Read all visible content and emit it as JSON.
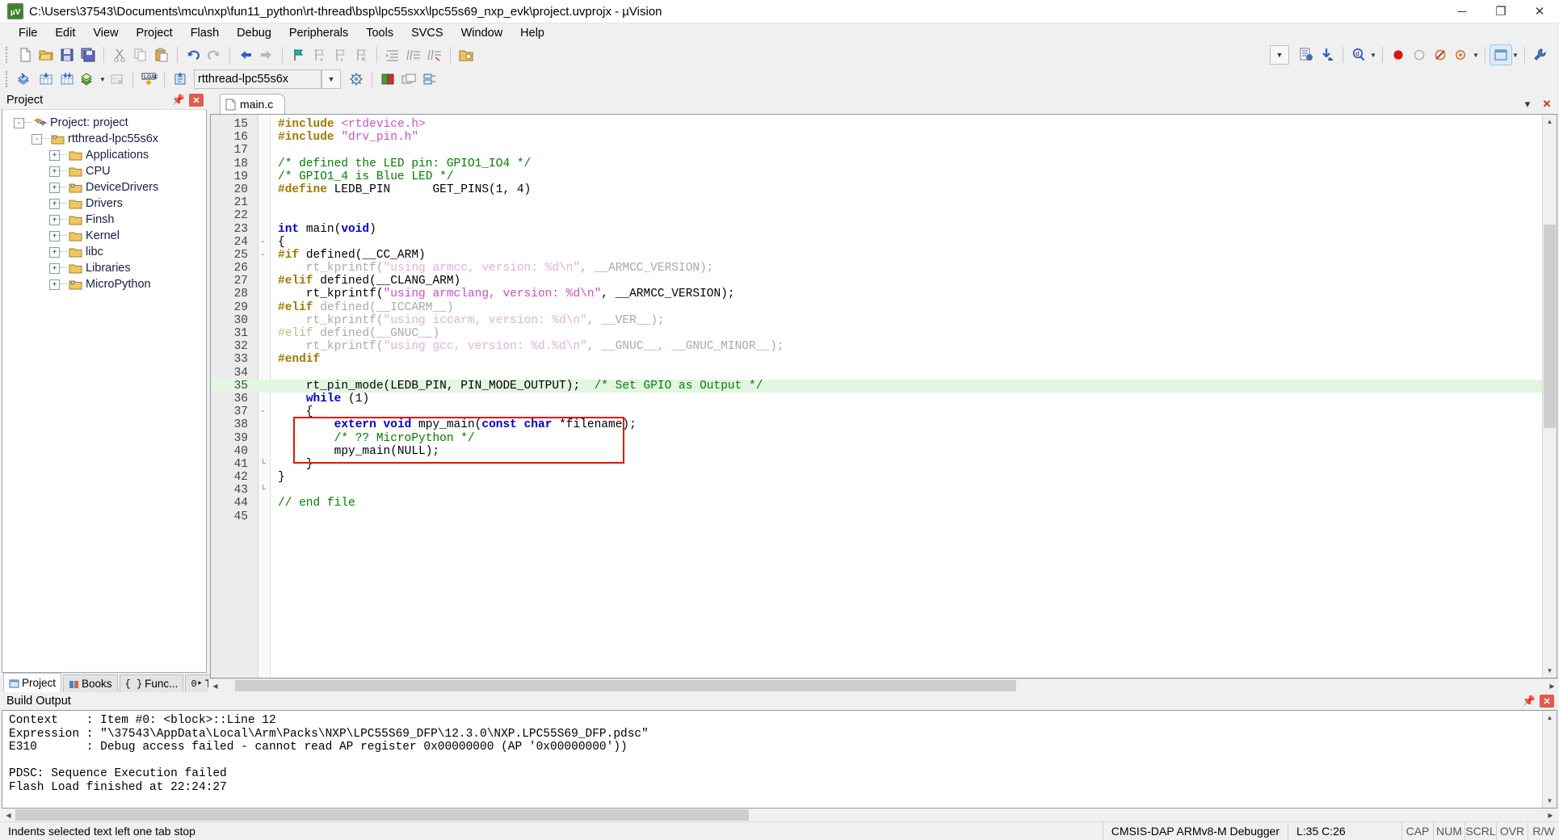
{
  "window": {
    "title": "C:\\Users\\37543\\Documents\\mcu\\nxp\\fun11_python\\rt-thread\\bsp\\lpc55sxx\\lpc55s69_nxp_evk\\project.uvprojx - µVision",
    "app_icon": "uvision-icon",
    "minimize": "─",
    "maximize": "❐",
    "close": "✕"
  },
  "menu": [
    {
      "label": "File"
    },
    {
      "label": "Edit"
    },
    {
      "label": "View"
    },
    {
      "label": "Project"
    },
    {
      "label": "Flash"
    },
    {
      "label": "Debug"
    },
    {
      "label": "Peripherals"
    },
    {
      "label": "Tools"
    },
    {
      "label": "SVCS"
    },
    {
      "label": "Window"
    },
    {
      "label": "Help"
    }
  ],
  "toolbar_main": [
    {
      "name": "new-file-icon"
    },
    {
      "name": "open-file-icon"
    },
    {
      "name": "save-icon"
    },
    {
      "name": "save-all-icon"
    },
    {
      "name": "cut-icon"
    },
    {
      "name": "copy-icon"
    },
    {
      "name": "paste-icon"
    },
    {
      "name": "undo-icon"
    },
    {
      "name": "redo-icon"
    },
    {
      "name": "navigate-back-icon"
    },
    {
      "name": "navigate-forward-icon"
    },
    {
      "name": "bookmark-toggle-icon"
    },
    {
      "name": "bookmark-prev-icon"
    },
    {
      "name": "bookmark-next-icon"
    },
    {
      "name": "bookmark-clear-icon"
    },
    {
      "name": "indent-icon"
    },
    {
      "name": "comment-icon"
    },
    {
      "name": "uncomment-icon"
    },
    {
      "name": "open-folder-icon"
    }
  ],
  "toolbar_right": [
    {
      "name": "combo-dropdown-icon"
    },
    {
      "name": "insert-file-icon"
    },
    {
      "name": "download-icon"
    },
    {
      "name": "find-in-files-icon"
    },
    {
      "name": "find-dropdown-icon"
    },
    {
      "name": "breakpoint-icon"
    },
    {
      "name": "breakpoint-disabled-icon"
    },
    {
      "name": "kill-breakpoints-icon"
    },
    {
      "name": "bookmarks-icon"
    },
    {
      "name": "bookmarks-dropdown-icon"
    },
    {
      "name": "window-layout-icon"
    },
    {
      "name": "window-layout-dropdown-icon"
    },
    {
      "name": "configure-icon"
    }
  ],
  "toolbar_build": [
    {
      "name": "translate-icon"
    },
    {
      "name": "build-icon"
    },
    {
      "name": "rebuild-icon"
    },
    {
      "name": "batch-build-icon"
    },
    {
      "name": "batch-build-dropdown-icon"
    },
    {
      "name": "stop-build-icon"
    },
    {
      "name": "download-flash-icon"
    },
    {
      "name": "target-options-icon"
    },
    {
      "name": "manage-project-items-icon"
    },
    {
      "name": "manage-run-time-icon"
    },
    {
      "name": "pack-installer-icon"
    },
    {
      "name": "manage-multi-project-icon"
    }
  ],
  "target": {
    "name": "rtthread-lpc55s6x",
    "dropdown_icon": "chevron-down-icon"
  },
  "project_pane": {
    "title": "Project",
    "pin_icon": "pin-icon",
    "close_icon": "close-icon",
    "tree": [
      {
        "label": "Project: project",
        "depth": 0,
        "expander": "-",
        "icon": "project-icon"
      },
      {
        "label": "rtthread-lpc55s6x",
        "depth": 1,
        "expander": "-",
        "icon": "target-folder-icon"
      },
      {
        "label": "Applications",
        "depth": 2,
        "expander": "+",
        "icon": "folder-icon"
      },
      {
        "label": "CPU",
        "depth": 2,
        "expander": "+",
        "icon": "folder-icon"
      },
      {
        "label": "DeviceDrivers",
        "depth": 2,
        "expander": "+",
        "icon": "folder-gear-icon"
      },
      {
        "label": "Drivers",
        "depth": 2,
        "expander": "+",
        "icon": "folder-icon"
      },
      {
        "label": "Finsh",
        "depth": 2,
        "expander": "+",
        "icon": "folder-icon"
      },
      {
        "label": "Kernel",
        "depth": 2,
        "expander": "+",
        "icon": "folder-icon"
      },
      {
        "label": "libc",
        "depth": 2,
        "expander": "+",
        "icon": "folder-icon"
      },
      {
        "label": "Libraries",
        "depth": 2,
        "expander": "+",
        "icon": "folder-icon"
      },
      {
        "label": "MicroPython",
        "depth": 2,
        "expander": "+",
        "icon": "folder-gear-icon"
      }
    ],
    "tabs": [
      {
        "label": "Project",
        "icon": "project-tab-icon",
        "active": true
      },
      {
        "label": "Books",
        "icon": "books-tab-icon",
        "active": false
      },
      {
        "label": "Func...",
        "icon": "functions-tab-icon",
        "active": false
      },
      {
        "label": "Temp...",
        "icon": "templates-tab-icon",
        "active": false
      }
    ]
  },
  "editor": {
    "tabs": [
      {
        "label": "main.c",
        "icon": "c-file-icon",
        "active": true
      }
    ],
    "window_minimize_icon": "▾",
    "window_close_icon": "✕",
    "highlight_line": 35,
    "red_box_lines": [
      38,
      40
    ],
    "lines": [
      {
        "num": 15,
        "fold": "",
        "tokens": [
          {
            "t": "#include ",
            "c": "pp"
          },
          {
            "t": "<rtdevice.h>",
            "c": "str"
          }
        ]
      },
      {
        "num": 16,
        "fold": "",
        "tokens": [
          {
            "t": "#include ",
            "c": "pp"
          },
          {
            "t": "\"drv_pin.h\"",
            "c": "str"
          }
        ]
      },
      {
        "num": 17,
        "fold": "",
        "tokens": []
      },
      {
        "num": 18,
        "fold": "",
        "tokens": [
          {
            "t": "/* defined the LED pin: GPIO1_IO4 */",
            "c": "cm"
          }
        ]
      },
      {
        "num": 19,
        "fold": "",
        "tokens": [
          {
            "t": "/* GPIO1_4 is Blue LED */",
            "c": "cm"
          }
        ]
      },
      {
        "num": 20,
        "fold": "",
        "tokens": [
          {
            "t": "#define ",
            "c": "pp"
          },
          {
            "t": "LEDB_PIN      GET_PINS(",
            "c": "id"
          },
          {
            "t": "1",
            "c": "num-lit"
          },
          {
            "t": ", ",
            "c": "id"
          },
          {
            "t": "4",
            "c": "num-lit"
          },
          {
            "t": ")",
            "c": "id"
          }
        ]
      },
      {
        "num": 21,
        "fold": "",
        "tokens": []
      },
      {
        "num": 22,
        "fold": "",
        "tokens": []
      },
      {
        "num": 23,
        "fold": "",
        "tokens": [
          {
            "t": "int ",
            "c": "k"
          },
          {
            "t": "main(",
            "c": "id"
          },
          {
            "t": "void",
            "c": "k"
          },
          {
            "t": ")",
            "c": "id"
          }
        ]
      },
      {
        "num": 24,
        "fold": "-",
        "tokens": [
          {
            "t": "{",
            "c": "id"
          }
        ]
      },
      {
        "num": 25,
        "fold": "-",
        "tokens": [
          {
            "t": "#if ",
            "c": "pp"
          },
          {
            "t": "defined(__CC_ARM)",
            "c": "id"
          }
        ]
      },
      {
        "num": 26,
        "fold": "",
        "tokens": [
          {
            "t": "    rt_kprintf(",
            "c": "dim"
          },
          {
            "t": "\"using armcc, version: %d\\n\"",
            "c": "str-dim"
          },
          {
            "t": ", __ARMCC_VERSION);",
            "c": "dim"
          }
        ]
      },
      {
        "num": 27,
        "fold": "",
        "tokens": [
          {
            "t": "#elif ",
            "c": "pp"
          },
          {
            "t": "defined(__CLANG_ARM)",
            "c": "id"
          }
        ]
      },
      {
        "num": 28,
        "fold": "",
        "tokens": [
          {
            "t": "    rt_kprintf(",
            "c": "id"
          },
          {
            "t": "\"using armclang, version: %d\\n\"",
            "c": "str"
          },
          {
            "t": ", __ARMCC_VERSION);",
            "c": "id"
          }
        ]
      },
      {
        "num": 29,
        "fold": "",
        "tokens": [
          {
            "t": "#elif ",
            "c": "pp"
          },
          {
            "t": "defined(__ICCARM__)",
            "c": "dim"
          }
        ]
      },
      {
        "num": 30,
        "fold": "",
        "tokens": [
          {
            "t": "    rt_kprintf(",
            "c": "dim"
          },
          {
            "t": "\"using iccarm, version: %d\\n\"",
            "c": "str-dim"
          },
          {
            "t": ", __VER__);",
            "c": "dim"
          }
        ]
      },
      {
        "num": 31,
        "fold": "",
        "tokens": [
          {
            "t": "#elif ",
            "c": "pp-dim"
          },
          {
            "t": "defined(__GNUC__)",
            "c": "dim"
          }
        ]
      },
      {
        "num": 32,
        "fold": "",
        "tokens": [
          {
            "t": "    rt_kprintf(",
            "c": "dim"
          },
          {
            "t": "\"using gcc, version: %d.%d\\n\"",
            "c": "str-dim"
          },
          {
            "t": ", __GNUC__, __GNUC_MINOR__);",
            "c": "dim"
          }
        ]
      },
      {
        "num": 33,
        "fold": "",
        "tokens": [
          {
            "t": "#endif",
            "c": "pp"
          }
        ]
      },
      {
        "num": 34,
        "fold": "",
        "tokens": []
      },
      {
        "num": 35,
        "fold": "",
        "tokens": [
          {
            "t": "    rt_pin_mode(LEDB_PIN, PIN_MODE_OUTPUT);  ",
            "c": "id"
          },
          {
            "t": "/* Set GPIO as Output */",
            "c": "cm"
          }
        ]
      },
      {
        "num": 36,
        "fold": "",
        "tokens": [
          {
            "t": "    ",
            "c": "id"
          },
          {
            "t": "while ",
            "c": "k"
          },
          {
            "t": "(",
            "c": "id"
          },
          {
            "t": "1",
            "c": "num-lit"
          },
          {
            "t": ")",
            "c": "id"
          }
        ]
      },
      {
        "num": 37,
        "fold": "-",
        "tokens": [
          {
            "t": "    {",
            "c": "id"
          }
        ]
      },
      {
        "num": 38,
        "fold": "",
        "tokens": [
          {
            "t": "        ",
            "c": "id"
          },
          {
            "t": "extern void ",
            "c": "k"
          },
          {
            "t": "mpy_main(",
            "c": "id"
          },
          {
            "t": "const char ",
            "c": "k"
          },
          {
            "t": "*filename);",
            "c": "id"
          }
        ]
      },
      {
        "num": 39,
        "fold": "",
        "tokens": [
          {
            "t": "        ",
            "c": "id"
          },
          {
            "t": "/* ?? MicroPython */",
            "c": "cm"
          }
        ]
      },
      {
        "num": 40,
        "fold": "",
        "tokens": [
          {
            "t": "        mpy_main(NULL);",
            "c": "id"
          }
        ]
      },
      {
        "num": 41,
        "fold": "└",
        "tokens": [
          {
            "t": "    }",
            "c": "id"
          }
        ]
      },
      {
        "num": 42,
        "fold": "",
        "tokens": [
          {
            "t": "}",
            "c": "id"
          }
        ]
      },
      {
        "num": 43,
        "fold": "└",
        "tokens": []
      },
      {
        "num": 44,
        "fold": "",
        "tokens": [
          {
            "t": "// end file",
            "c": "cm"
          }
        ]
      },
      {
        "num": 45,
        "fold": "",
        "tokens": []
      }
    ]
  },
  "build_output": {
    "title": "Build Output",
    "pin_icon": "pin-icon",
    "close_icon": "close-icon",
    "lines": [
      "Context    : Item #0: <block>::Line 12",
      "Expression : \"\\37543\\AppData\\Local\\Arm\\Packs\\NXP\\LPC55S69_DFP\\12.3.0\\NXP.LPC55S69_DFP.pdsc\"",
      "E310       : Debug access failed - cannot read AP register 0x00000000 (AP '0x00000000'))",
      "",
      "PDSC: Sequence Execution failed",
      "Flash Load finished at 22:24:27"
    ]
  },
  "statusbar": {
    "message": "Indents selected text left one tab stop",
    "debugger": "CMSIS-DAP ARMv8-M Debugger",
    "position": "L:35 C:26",
    "flags": [
      "CAP",
      "NUM",
      "SCRL",
      "OVR",
      "R/W"
    ]
  },
  "colors": {
    "accent": "#e81400",
    "highlight": "#e2f6e2",
    "keyword": "#0000c8",
    "string": "#c850c8",
    "comment": "#008000",
    "preprocessor": "#a07800"
  }
}
